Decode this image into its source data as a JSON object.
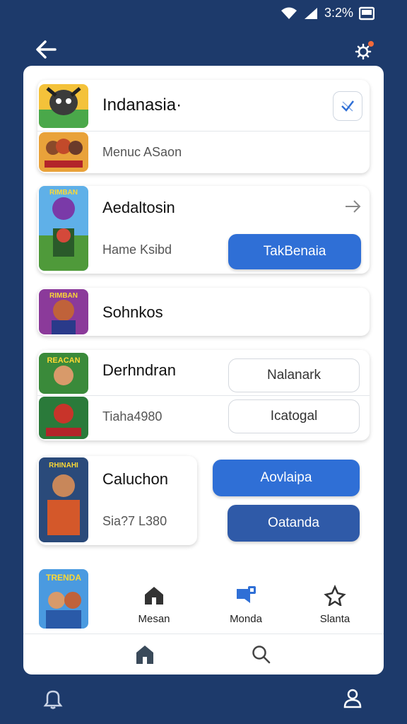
{
  "status": {
    "battery": "3:2%"
  },
  "items": [
    {
      "title": "Indanasia·",
      "subtitle": "Menuc ASaon"
    },
    {
      "title": "Aedaltosin",
      "subtitle": "Hame Ksibd",
      "button": "TakBenaia"
    },
    {
      "title": "Sohnkos"
    },
    {
      "title": "Derhndran",
      "subtitle": "Tiaha4980",
      "button1": "Nalanark",
      "button2": "Icatogal"
    },
    {
      "title": "Caluchon",
      "subtitle": "Sia?7 L380",
      "button1": "Aovlaipa",
      "button2": "Oatanda"
    }
  ],
  "thumb_labels": [
    "RIMBAN",
    "REACAN",
    "RHINAHI",
    "TRENDA"
  ],
  "tabs": [
    {
      "label": "Mesan",
      "icon": "home-icon"
    },
    {
      "label": "Monda",
      "icon": "chat-icon"
    },
    {
      "label": "Slanta",
      "icon": "star-icon"
    }
  ],
  "colors": {
    "accent": "#2f6fd6",
    "background": "#1d3a6b"
  }
}
